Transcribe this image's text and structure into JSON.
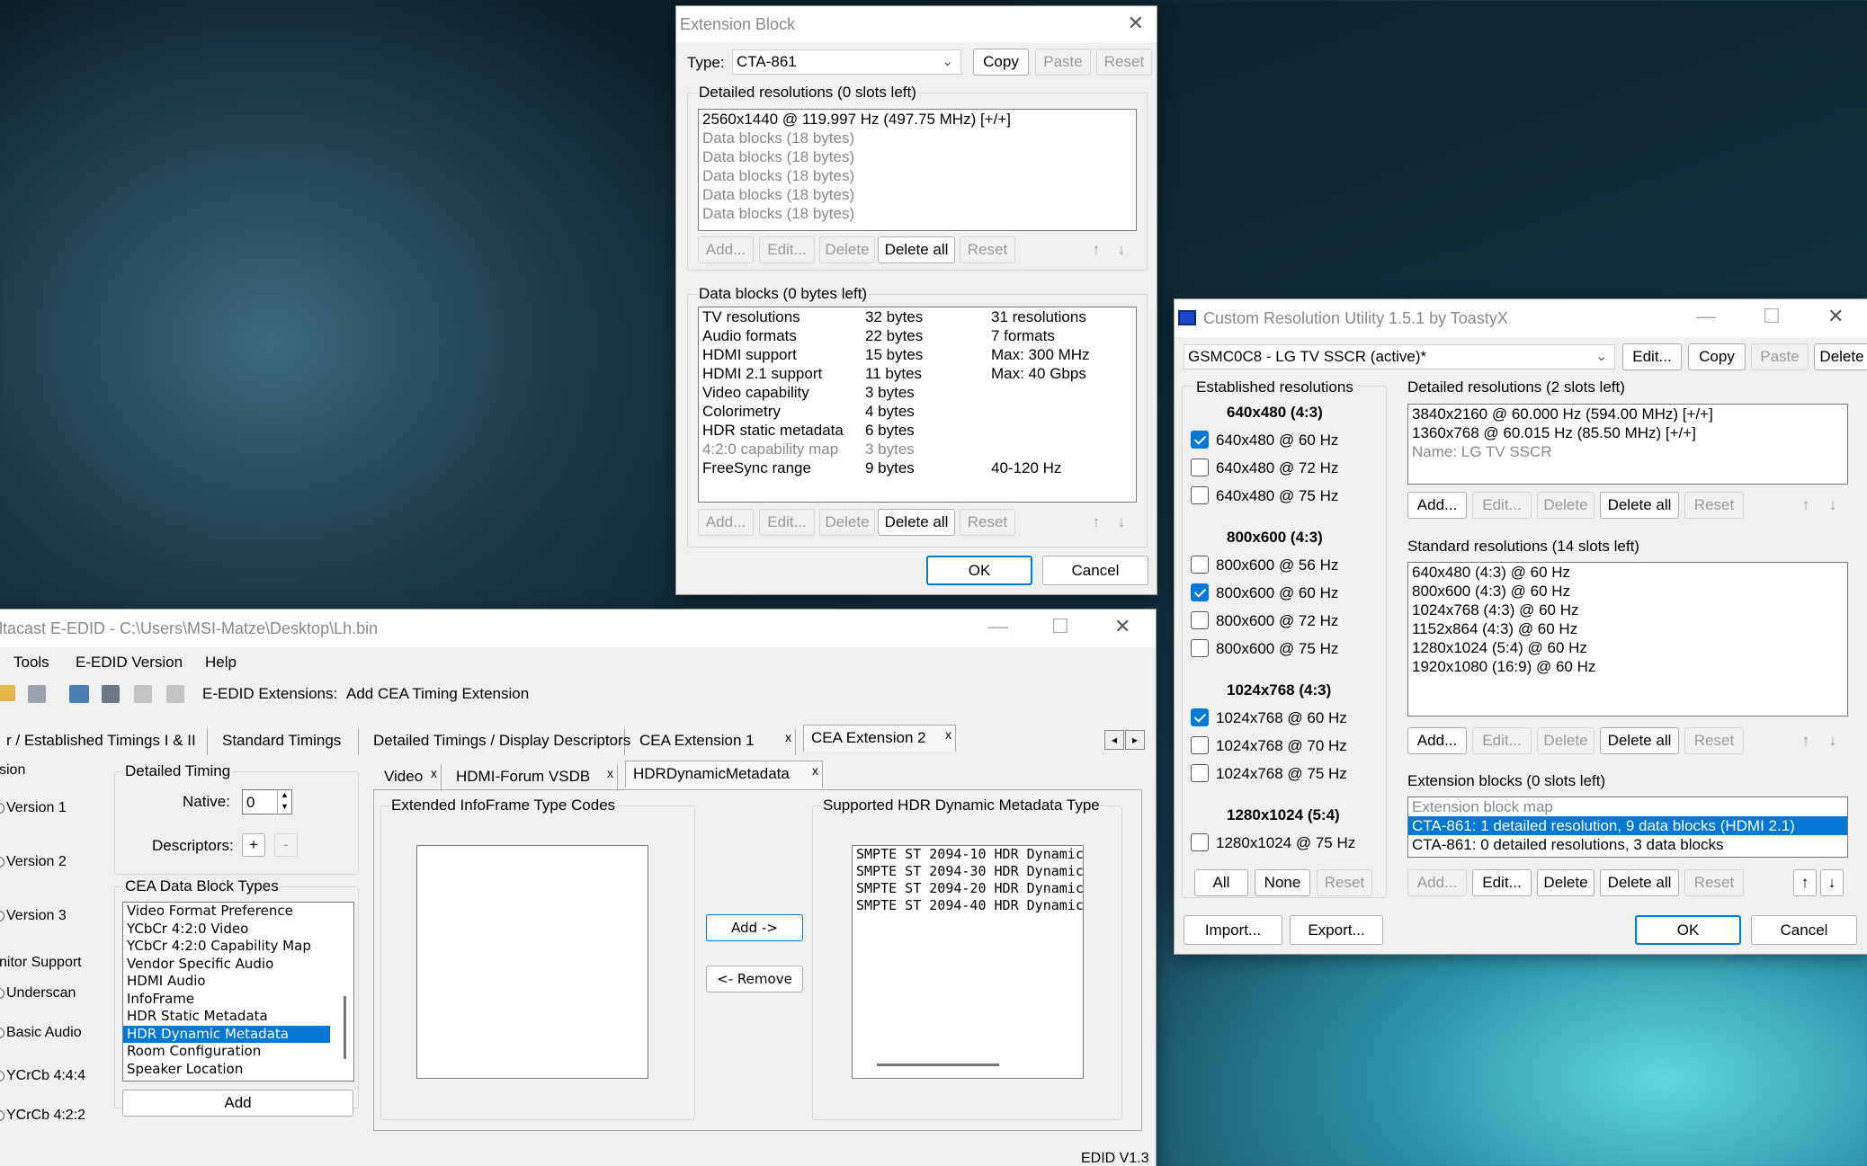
{
  "ext": {
    "title": "Extension Block",
    "type_label": "Type:",
    "type_value": "CTA-861",
    "copy": "Copy",
    "paste": "Paste",
    "reset": "Reset",
    "detailed_title": "Detailed resolutions (0 slots left)",
    "detailed_rows": [
      "2560x1440 @ 119.997 Hz (497.75 MHz) [+/+]",
      "Data blocks (18 bytes)",
      "Data blocks (18 bytes)",
      "Data blocks (18 bytes)",
      "Data blocks (18 bytes)",
      "Data blocks (18 bytes)"
    ],
    "add": "Add...",
    "edit": "Edit...",
    "delete": "Delete",
    "delete_all": "Delete all",
    "up_icon": "↑",
    "down_icon": "↓",
    "data_title": "Data blocks (0 bytes left)",
    "data_rows": [
      {
        "name": "TV resolutions",
        "size": "32 bytes",
        "info": "31 resolutions"
      },
      {
        "name": "Audio formats",
        "size": "22 bytes",
        "info": "7 formats"
      },
      {
        "name": "HDMI support",
        "size": "15 bytes",
        "info": "Max: 300 MHz"
      },
      {
        "name": "HDMI 2.1 support",
        "size": "11 bytes",
        "info": "Max: 40 Gbps"
      },
      {
        "name": "Video capability",
        "size": "3 bytes",
        "info": ""
      },
      {
        "name": "Colorimetry",
        "size": "4 bytes",
        "info": ""
      },
      {
        "name": "HDR static metadata",
        "size": "6 bytes",
        "info": ""
      },
      {
        "name": "4:2:0 capability map",
        "size": "3 bytes",
        "info": ""
      },
      {
        "name": "FreeSync range",
        "size": "9 bytes",
        "info": "40-120 Hz"
      }
    ],
    "ok": "OK",
    "cancel": "Cancel",
    "close_icon": "✕"
  },
  "cru": {
    "title": "Custom Resolution Utility 1.5.1 by ToastyX",
    "monitor": "GSMC0C8 - LG TV SSCR (active)*",
    "edit": "Edit...",
    "copy": "Copy",
    "paste": "Paste",
    "delete": "Delete",
    "established_title": "Established resolutions",
    "established": [
      {
        "head": "640x480 (4:3)",
        "items": [
          {
            "label": "640x480 @ 60 Hz",
            "checked": true
          },
          {
            "label": "640x480 @ 72 Hz",
            "checked": false
          },
          {
            "label": "640x480 @ 75 Hz",
            "checked": false
          }
        ]
      },
      {
        "head": "800x600 (4:3)",
        "items": [
          {
            "label": "800x600 @ 56 Hz",
            "checked": false
          },
          {
            "label": "800x600 @ 60 Hz",
            "checked": true
          },
          {
            "label": "800x600 @ 72 Hz",
            "checked": false
          },
          {
            "label": "800x600 @ 75 Hz",
            "checked": false
          }
        ]
      },
      {
        "head": "1024x768 (4:3)",
        "items": [
          {
            "label": "1024x768 @ 60 Hz",
            "checked": true
          },
          {
            "label": "1024x768 @ 70 Hz",
            "checked": false
          },
          {
            "label": "1024x768 @ 75 Hz",
            "checked": false
          }
        ]
      },
      {
        "head": "1280x1024 (5:4)",
        "items": [
          {
            "label": "1280x1024 @ 75 Hz",
            "checked": false
          }
        ]
      }
    ],
    "all": "All",
    "none": "None",
    "reset": "Reset",
    "detailed_title": "Detailed resolutions (2 slots left)",
    "detailed_rows": [
      "3840x2160 @ 60.000 Hz (594.00 MHz) [+/+]",
      "1360x768 @ 60.015 Hz (85.50 MHz) [+/+]",
      "Name: LG TV SSCR"
    ],
    "standard_title": "Standard resolutions (14 slots left)",
    "standard_rows": [
      "640x480 (4:3) @ 60 Hz",
      "800x600 (4:3) @ 60 Hz",
      "1024x768 (4:3) @ 60 Hz",
      "1152x864 (4:3) @ 60 Hz",
      "1280x1024 (5:4) @ 60 Hz",
      "1920x1080 (16:9) @ 60 Hz"
    ],
    "ext_title": "Extension blocks (0 slots left)",
    "ext_rows": [
      "Extension block map",
      "CTA-861: 1 detailed resolution, 9 data blocks (HDMI 2.1)",
      "CTA-861: 0 detailed resolutions, 3 data blocks"
    ],
    "add": "Add...",
    "delete_all": "Delete all",
    "import": "Import...",
    "export": "Export...",
    "ok": "OK",
    "cancel": "Cancel",
    "min_icon": "—",
    "max_icon": "☐",
    "close_icon": "✕",
    "up_icon": "↑",
    "down_icon": "↓"
  },
  "dc": {
    "title": "ltacast E-EDID - C:\\Users\\MSI-Matze\\Desktop\\Lh.bin",
    "menu": [
      "Tools",
      "E-EDID Version",
      "Help"
    ],
    "toolbar_text": "E-EDID Extensions:",
    "toolbar_action": "Add CEA Timing Extension",
    "tabs": [
      "r / Established Timings I & II",
      "Standard Timings",
      "Detailed Timings / Display Descriptors",
      "CEA Extension 1",
      "CEA Extension 2"
    ],
    "subtabs": [
      "Video",
      "HDMI-Forum VSDB",
      "HDRDynamicMetadata"
    ],
    "left": [
      "sion",
      "Version 1",
      "Version 2",
      "Version 3",
      "nitor Support",
      "Underscan",
      "Basic Audio",
      "YCrCb 4:4:4",
      "YCrCb 4:2:2"
    ],
    "detailed_timing": "Detailed Timing",
    "native": "Native:",
    "native_value": "0",
    "descriptors": "Descriptors:",
    "plus": "+",
    "minus": "-",
    "cea_title": "CEA Data Block Types",
    "cea_rows": [
      "Video Format Preference",
      "YCbCr 4:2:0 Video",
      "YCbCr 4:2:0 Capability Map",
      "Vendor Specific Audio",
      "HDMI Audio",
      "InfoFrame",
      "HDR Static Metadata",
      "HDR Dynamic Metadata",
      "Room Configuration",
      "Speaker Location"
    ],
    "add": "Add",
    "extended_title": "Extended InfoFrame Type Codes",
    "supported_title": "Supported HDR Dynamic Metadata Type",
    "supported_rows": [
      "SMPTE ST 2094-10 HDR Dynamic",
      "SMPTE ST 2094-30 HDR Dynamic",
      "SMPTE ST 2094-20 HDR Dynamic",
      "SMPTE ST 2094-40 HDR Dynamic"
    ],
    "add_btn": "Add ->",
    "remove_btn": "<- Remove",
    "status": "EDID V1.3",
    "min_icon": "—",
    "max_icon": "☐",
    "close_icon": "✕",
    "tab_close": "x"
  }
}
